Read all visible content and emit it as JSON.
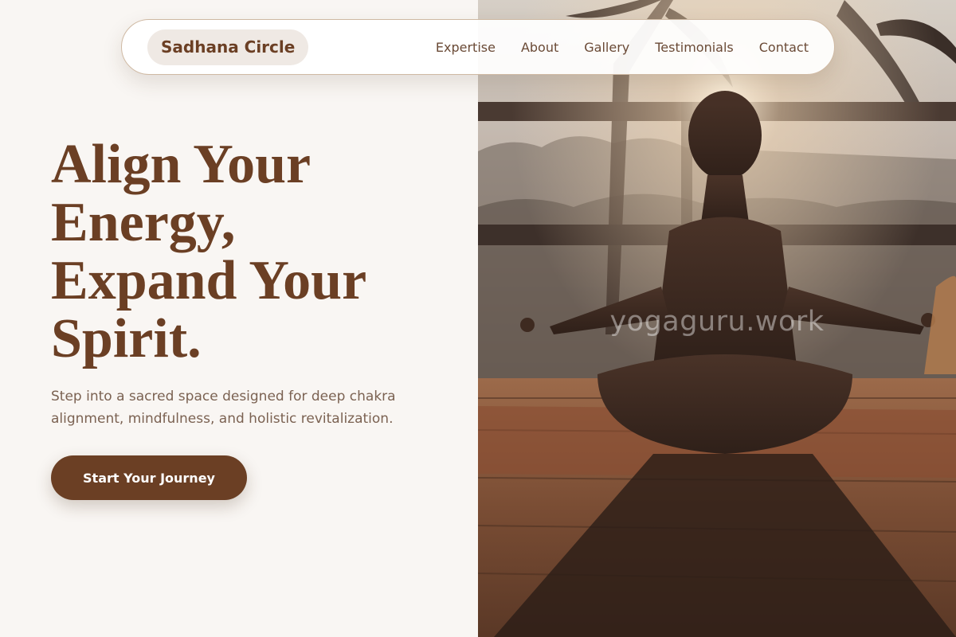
{
  "brand": {
    "name": "Sadhana Circle"
  },
  "nav": {
    "links": [
      "Expertise",
      "About",
      "Gallery",
      "Testimonials",
      "Contact"
    ]
  },
  "hero": {
    "title_lines": [
      "Align Your",
      "Energy,",
      "Expand Your",
      "Spirit."
    ],
    "subtitle": "Step into a sacred space designed for deep chakra alignment, mindfulness, and holistic revitalization.",
    "cta_label": "Start Your Journey"
  },
  "photo": {
    "watermark": "yogaguru.work",
    "subject": "woman meditating in lotus pose at sunset on wooden deck"
  },
  "colors": {
    "background": "#f9f6f3",
    "brand_brown": "#6b3f24",
    "text_muted": "#7b6252",
    "nav_link": "#6a4a36"
  }
}
